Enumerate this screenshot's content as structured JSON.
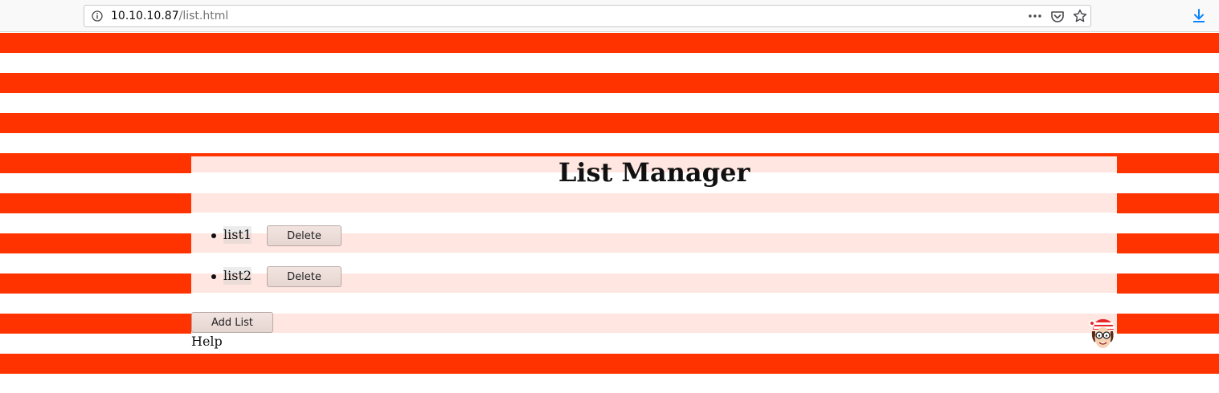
{
  "browser": {
    "url_host": "10.10.10.87",
    "url_path": "/list.html"
  },
  "page": {
    "title": "List Manager",
    "lists": [
      {
        "name": "list1",
        "delete_label": "Delete"
      },
      {
        "name": "list2",
        "delete_label": "Delete"
      }
    ],
    "add_label": "Add List",
    "help_label": "Help"
  },
  "colors": {
    "stripe_red": "#ff3300",
    "stripe_white": "#ffffff"
  },
  "icons": [
    "info-icon",
    "page-actions-icon",
    "pocket-icon",
    "star-icon",
    "download-icon",
    "waldo-icon"
  ]
}
